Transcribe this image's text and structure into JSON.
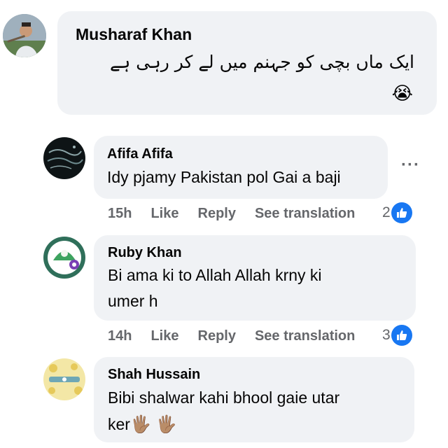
{
  "comments": [
    {
      "author": "Musharaf Khan",
      "text": "ایک ماں بچی کو جہنم میں لے کر رہی ہے",
      "emoji": "😭"
    },
    {
      "author": "Afifa Afifa",
      "text": "Idy pjamy Pakistan pol Gai a baji",
      "time": "15h",
      "like_label": "Like",
      "reply_label": "Reply",
      "translate_label": "See translation",
      "reaction_count": "2",
      "more_label": "···"
    },
    {
      "author": "Ruby Khan",
      "text_line1": "Bi ama ki to Allah Allah krny ki",
      "text_line2": "umer h",
      "time": "14h",
      "like_label": "Like",
      "reply_label": "Reply",
      "translate_label": "See translation",
      "reaction_count": "3"
    },
    {
      "author": "Shah Hussain",
      "text_line1": "Bibi shalwar kahi bhool gaie utar",
      "text_line2": "ker",
      "emoji": "🖐🏽 🖐🏽"
    }
  ],
  "colors": {
    "bubble": "#f0f2f5",
    "meta_text": "#65676b",
    "like_blue": "#1877f2"
  }
}
